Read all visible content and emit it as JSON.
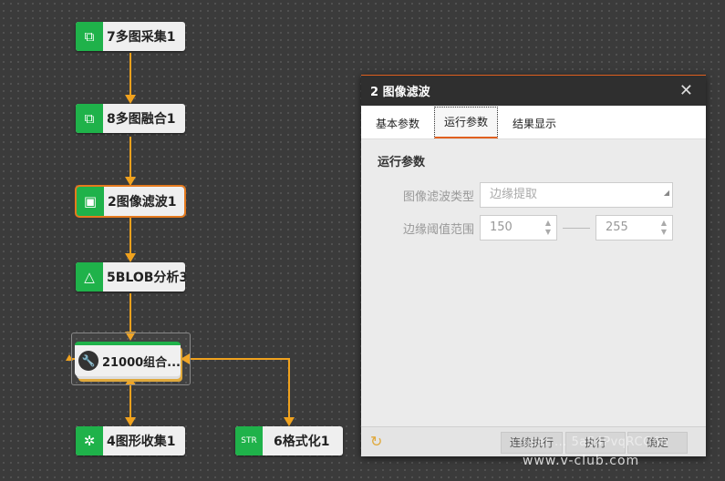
{
  "flow": {
    "nodes": [
      {
        "label": "7多图采集1",
        "icon": "multi-image-capture-icon"
      },
      {
        "label": "8多图融合1",
        "icon": "multi-image-fusion-icon"
      },
      {
        "label": "2图像滤波1",
        "icon": "image-filter-icon"
      },
      {
        "label": "5BLOB分析3",
        "icon": "blob-analysis-icon"
      },
      {
        "label": "21000组合...",
        "icon": "wrench-icon"
      },
      {
        "label": "4图形收集1",
        "icon": "shape-collect-icon"
      },
      {
        "label": "6格式化1",
        "icon": "format-icon"
      }
    ],
    "colors": {
      "node_icon_bg": "#1fb24a",
      "link": "#f0a21e",
      "selected": "#e57a1e"
    }
  },
  "dialog": {
    "title": "2 图像滤波",
    "close": "✕",
    "tabs": [
      "基本参数",
      "运行参数",
      "结果显示"
    ],
    "active_tab": "运行参数",
    "section": "运行参数",
    "fields": {
      "filter_type_label": "图像滤波类型",
      "filter_type_value": "边缘提取",
      "threshold_label": "边缘阈值范围",
      "threshold_min": "150",
      "threshold_max": "255"
    },
    "footer": {
      "run_continuous": "连续执行",
      "run": "执行",
      "ok": "确定"
    }
  },
  "watermark": {
    "line1": "user ... 5aS4PvqRCG6b",
    "line2": "www.v-club.com"
  }
}
